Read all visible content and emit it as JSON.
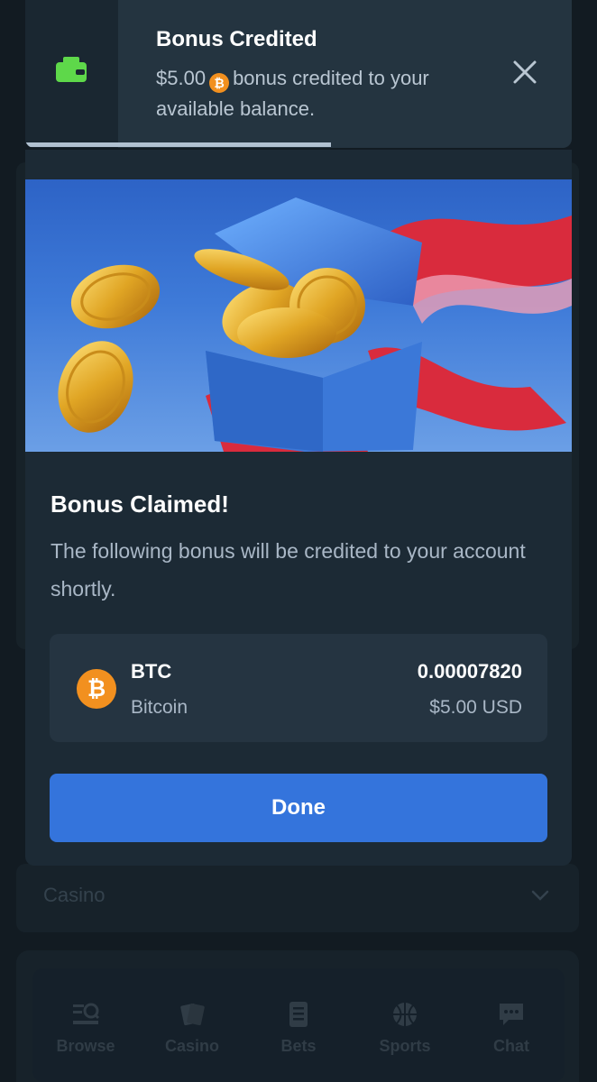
{
  "toast": {
    "title": "Bonus Credited",
    "amount": "$5.00",
    "message_rest": "bonus credited to your available balance.",
    "progress": 0.56,
    "icon": "wallet-icon",
    "close_icon": "close-icon"
  },
  "modal": {
    "title": "Bonus Claimed!",
    "description": "The following bonus will be credited to your account shortly.",
    "asset": {
      "code": "BTC",
      "name": "Bitcoin",
      "amount": "0.00007820",
      "usd_value": "$5.00 USD",
      "icon_symbol": "₿"
    },
    "done_label": "Done"
  },
  "background": {
    "casino_label": "Casino",
    "nav": [
      {
        "label": "Browse",
        "icon": "browse-icon"
      },
      {
        "label": "Casino",
        "icon": "cards-icon"
      },
      {
        "label": "Bets",
        "icon": "betslip-icon"
      },
      {
        "label": "Sports",
        "icon": "basketball-icon"
      },
      {
        "label": "Chat",
        "icon": "chat-icon"
      }
    ]
  },
  "colors": {
    "accent": "#3474dc",
    "bitcoin": "#f2901f",
    "wallet": "#5ed84a",
    "background": "#121b22",
    "panel": "#1c2a35"
  }
}
